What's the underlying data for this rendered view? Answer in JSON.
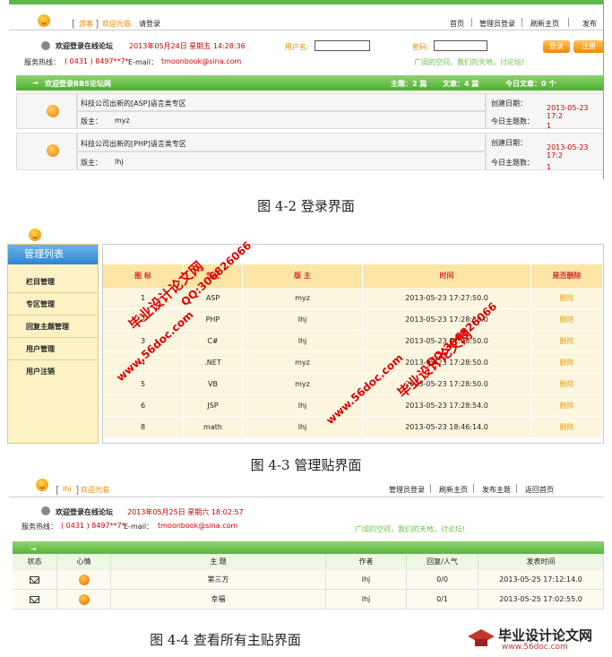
{
  "fig1": {
    "guest": "游客",
    "welcome_short": "欢迎光临",
    "please_login": "请登录",
    "nav": [
      "首页",
      "管理员登录",
      "刷新主页",
      "发布"
    ],
    "welcome": "欢迎登录在线论坛",
    "date": "2013年05月24日 星期五 14:28:36",
    "hotline_label": "服务热线：",
    "hotline": "( 0431 ) 8497**7*",
    "email_label": "E-mail：",
    "email": "tmoonbook@sina.com",
    "username_label": "用户名:",
    "password_label": "密码:",
    "slogan": "广阔的空间，我们的天地，讨论坛!",
    "login_btn": "登录",
    "register_btn": "注册",
    "bar_title": "欢迎登录BBS论坛网",
    "bar_topics": "主题：2 篇",
    "bar_articles": "文章：4 篇",
    "bar_today": "今日文章：0 个",
    "rows": [
      {
        "title": "科技公司出新的[ASP]语言类专区",
        "mod_label": "版主：",
        "mod": "myz",
        "created_label": "创建日期：",
        "created": "2013-05-23 17:2",
        "today_label": "今日主题数：",
        "today": "1"
      },
      {
        "title": "科技公司出新的[PHP]语言类专区",
        "mod_label": "版主：",
        "mod": "lhj",
        "created_label": "创建日期：",
        "created": "2013-05-23 17:2",
        "today_label": "今日主题数：",
        "today": "1"
      }
    ],
    "caption": "图 4-2   登录界面"
  },
  "fig2": {
    "sidebar_title": "管理列表",
    "sidebar_items": [
      "栏目管理",
      "专区管理",
      "回复主题管理",
      "用户管理",
      "用户注销"
    ],
    "headers": [
      "图  标",
      "专区",
      "版  主",
      "时间",
      "是否删除"
    ],
    "rows": [
      [
        "1",
        "ASP",
        "myz",
        "2013-05-23 17:27:50.0",
        "删除"
      ],
      [
        "2",
        "PHP",
        "lhj",
        "2013-05-23 17:28:50.0",
        "删除"
      ],
      [
        "3",
        "C#",
        "lhj",
        "2013-05-23 17:28:50.0",
        "删除"
      ],
      [
        "4",
        ".NET",
        "myz",
        "2013-05-23 17:28:50.0",
        "删除"
      ],
      [
        "5",
        "VB",
        "myz",
        "2013-05-23 17:28:50.0",
        "删除"
      ],
      [
        "6",
        "JSP",
        "lhj",
        "2013-05-23 17:28:54.0",
        "删除"
      ],
      [
        "8",
        "math",
        "lhj",
        "2013-05-23 18:46:14.0",
        "删除"
      ]
    ],
    "watermarks": [
      "毕业设计论文网",
      "QQ:306826066",
      "www.56doc.com"
    ],
    "caption": "图 4-3   管理贴界面"
  },
  "fig3": {
    "user": "lhj",
    "welcome_short": "欢迎光临",
    "nav": [
      "管理员登录",
      "刷新主页",
      "发布主题",
      "返回首页"
    ],
    "welcome": "欢迎登录在线论坛",
    "date": "2013年05月25日 星期六 18:02:57",
    "hotline_label": "服务热线：",
    "hotline": "( 0431 ) 8497**7*",
    "email_label": "E-mail：",
    "email": "tmoonbook@sina.com",
    "slogan": "广阔的空间，我们的天地，讨论坛!",
    "headers": [
      "状态",
      "心情",
      "主    题",
      "作者",
      "回复/人气",
      "发表时间"
    ],
    "rows": [
      [
        "第三方",
        "lhj",
        "0/0",
        "2013-05-25 17:12:14.0"
      ],
      [
        "幸福",
        "lhj",
        "0/1",
        "2013-05-25 17:02:55.0"
      ]
    ],
    "caption": "图 4-4   查看所有主贴界面"
  },
  "logo": {
    "name": "毕业设计论文网",
    "url": "www.56doc.com"
  }
}
